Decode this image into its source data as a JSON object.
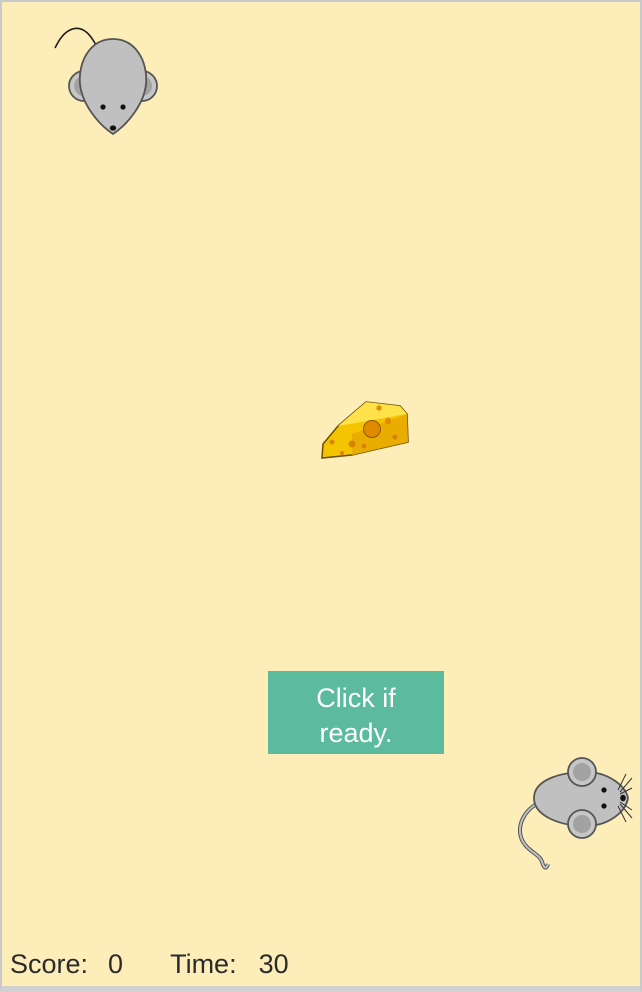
{
  "game": {
    "background_color": "#fdedb9",
    "button_color": "#5bbb9c",
    "start_button_label": "Click if ready."
  },
  "status": {
    "score_label": "Score:",
    "score_value": "0",
    "time_label": "Time:",
    "time_value": "30"
  },
  "sprites": {
    "player_mouse": "mouse-icon",
    "enemy_mouse": "mouse-icon",
    "target": "cheese-icon"
  }
}
